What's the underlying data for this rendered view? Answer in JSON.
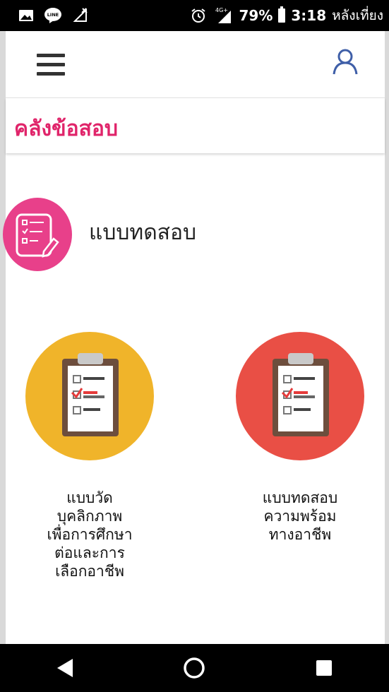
{
  "status_bar": {
    "battery_percent": "79%",
    "time": "3:18",
    "time_suffix": "หลังเที่ยง",
    "network": "4G+",
    "line_badge": "LINE",
    "colors": {
      "background": "#000000",
      "foreground": "#ffffff"
    }
  },
  "header": {
    "menu_icon": "hamburger-menu-icon",
    "user_icon": "user-profile-icon",
    "accent": "#3f5fa8"
  },
  "page": {
    "title": "คลังข้อสอบ",
    "title_color": "#e0246a"
  },
  "section": {
    "title": "แบบทดสอบ",
    "icon": "checklist-pencil-icon",
    "icon_bg": "#e8408a"
  },
  "quizzes": [
    {
      "label": "แบบวัด\nบุคลิกภาพ\nเพื่อการศึกษา\nต่อและการ\nเลือกอาชีพ",
      "icon": "clipboard-checklist-icon",
      "icon_bg": "#f0b42a"
    },
    {
      "label": "แบบทดสอบ\nความพร้อม\nทางอาชีพ",
      "icon": "clipboard-checklist-icon",
      "icon_bg": "#e94f45"
    }
  ],
  "nav": {
    "back_icon": "back-triangle-icon",
    "home_icon": "home-circle-icon",
    "recents_icon": "recents-square-icon"
  }
}
